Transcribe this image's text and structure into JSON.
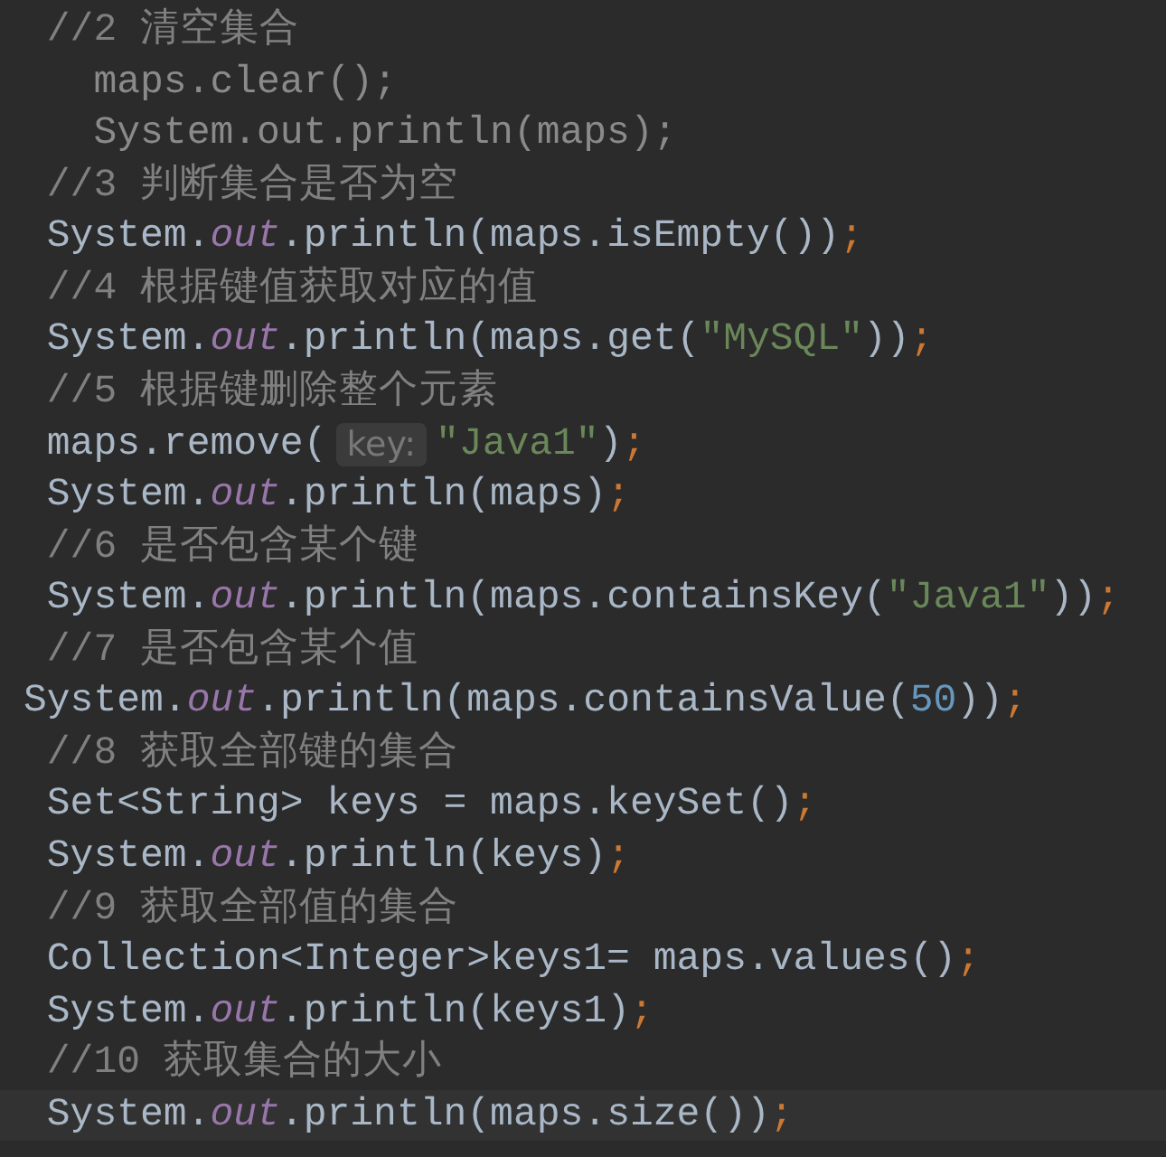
{
  "editor": {
    "lines": [
      {
        "current": false,
        "tokens": [
          {
            "kind": "comment",
            "text": " //2 清空集合"
          }
        ]
      },
      {
        "current": false,
        "tokens": [
          {
            "kind": "dim",
            "text": "   maps.clear();"
          }
        ]
      },
      {
        "current": false,
        "tokens": [
          {
            "kind": "dim",
            "text": "   System.out.println(maps);"
          }
        ]
      },
      {
        "current": false,
        "tokens": [
          {
            "kind": "comment",
            "text": " //3 判断集合是否为空"
          }
        ]
      },
      {
        "current": false,
        "tokens": [
          {
            "kind": "plain",
            "text": " System."
          },
          {
            "kind": "field",
            "text": "out"
          },
          {
            "kind": "plain",
            "text": ".println(maps.isEmpty())"
          },
          {
            "kind": "keyword",
            "text": ";"
          }
        ]
      },
      {
        "current": false,
        "tokens": [
          {
            "kind": "comment",
            "text": " //4 根据键值获取对应的值"
          }
        ]
      },
      {
        "current": false,
        "tokens": [
          {
            "kind": "plain",
            "text": " System."
          },
          {
            "kind": "field",
            "text": "out"
          },
          {
            "kind": "plain",
            "text": ".println(maps.get("
          },
          {
            "kind": "string",
            "text": "\"MySQL\""
          },
          {
            "kind": "plain",
            "text": "))"
          },
          {
            "kind": "keyword",
            "text": ";"
          }
        ]
      },
      {
        "current": false,
        "tokens": [
          {
            "kind": "comment",
            "text": " //5 根据键删除整个元素"
          }
        ]
      },
      {
        "current": false,
        "tokens": [
          {
            "kind": "plain",
            "text": " maps.remove("
          },
          {
            "kind": "hint",
            "text": "key:"
          },
          {
            "kind": "string",
            "text": "\"Java1\""
          },
          {
            "kind": "plain",
            "text": ")"
          },
          {
            "kind": "keyword",
            "text": ";"
          }
        ]
      },
      {
        "current": false,
        "tokens": [
          {
            "kind": "plain",
            "text": " System."
          },
          {
            "kind": "field",
            "text": "out"
          },
          {
            "kind": "plain",
            "text": ".println(maps)"
          },
          {
            "kind": "keyword",
            "text": ";"
          }
        ]
      },
      {
        "current": false,
        "tokens": [
          {
            "kind": "comment",
            "text": " //6 是否包含某个键"
          }
        ]
      },
      {
        "current": false,
        "tokens": [
          {
            "kind": "plain",
            "text": " System."
          },
          {
            "kind": "field",
            "text": "out"
          },
          {
            "kind": "plain",
            "text": ".println(maps.containsKey("
          },
          {
            "kind": "string",
            "text": "\"Java1\""
          },
          {
            "kind": "plain",
            "text": "))"
          },
          {
            "kind": "keyword",
            "text": ";"
          }
        ]
      },
      {
        "current": false,
        "tokens": [
          {
            "kind": "comment",
            "text": " //7 是否包含某个值"
          }
        ]
      },
      {
        "current": false,
        "tokens": [
          {
            "kind": "plain",
            "text": "System."
          },
          {
            "kind": "field",
            "text": "out"
          },
          {
            "kind": "plain",
            "text": ".println(maps.containsValue("
          },
          {
            "kind": "number",
            "text": "50"
          },
          {
            "kind": "plain",
            "text": "))"
          },
          {
            "kind": "keyword",
            "text": ";"
          }
        ]
      },
      {
        "current": false,
        "tokens": [
          {
            "kind": "comment",
            "text": " //8 获取全部键的集合"
          }
        ]
      },
      {
        "current": false,
        "tokens": [
          {
            "kind": "plain",
            "text": " Set<String> keys = maps.keySet()"
          },
          {
            "kind": "keyword",
            "text": ";"
          }
        ]
      },
      {
        "current": false,
        "tokens": [
          {
            "kind": "plain",
            "text": " System."
          },
          {
            "kind": "field",
            "text": "out"
          },
          {
            "kind": "plain",
            "text": ".println(keys)"
          },
          {
            "kind": "keyword",
            "text": ";"
          }
        ]
      },
      {
        "current": false,
        "tokens": [
          {
            "kind": "comment",
            "text": " //9 获取全部值的集合"
          }
        ]
      },
      {
        "current": false,
        "tokens": [
          {
            "kind": "plain",
            "text": " Collection<Integer>keys1= maps.values()"
          },
          {
            "kind": "keyword",
            "text": ";"
          }
        ]
      },
      {
        "current": false,
        "tokens": [
          {
            "kind": "plain",
            "text": " System."
          },
          {
            "kind": "field",
            "text": "out"
          },
          {
            "kind": "plain",
            "text": ".println(keys1)"
          },
          {
            "kind": "keyword",
            "text": ";"
          }
        ]
      },
      {
        "current": false,
        "tokens": [
          {
            "kind": "comment",
            "text": " //10 获取集合的大小"
          }
        ]
      },
      {
        "current": true,
        "tokens": [
          {
            "kind": "plain",
            "text": " System."
          },
          {
            "kind": "field",
            "text": "out"
          },
          {
            "kind": "plain",
            "text": ".println(maps.size())"
          },
          {
            "kind": "keyword",
            "text": ";"
          }
        ]
      }
    ]
  }
}
